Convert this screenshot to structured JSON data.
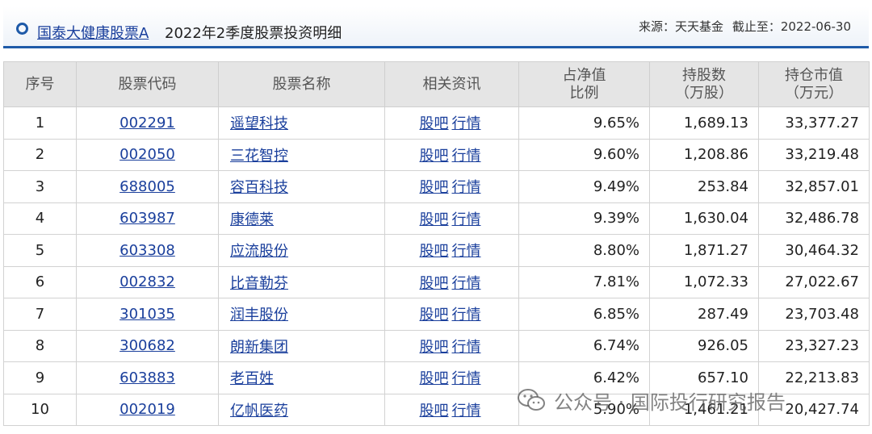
{
  "header": {
    "fund_name": "国泰大健康股票A",
    "title": "2022年2季度股票投资明细",
    "source_label": "来源：天天基金",
    "date_label": "截止至：2022-06-30"
  },
  "table": {
    "columns": [
      "序号",
      "股票代码",
      "股票名称",
      "相关资讯",
      "占净值比例",
      "持股数（万股）",
      "持仓市值（万元）"
    ],
    "column_lines": [
      [
        "序号"
      ],
      [
        "股票代码"
      ],
      [
        "股票名称"
      ],
      [
        "相关资讯"
      ],
      [
        "占净值",
        "比例"
      ],
      [
        "持股数",
        "（万股）"
      ],
      [
        "持仓市值",
        "（万元）"
      ]
    ],
    "info_links": [
      "股吧",
      "行情"
    ],
    "rows": [
      {
        "no": "1",
        "code": "002291",
        "name": "遥望科技",
        "pct": "9.65%",
        "shares": "1,689.13",
        "value": "33,377.27"
      },
      {
        "no": "2",
        "code": "002050",
        "name": "三花智控",
        "pct": "9.60%",
        "shares": "1,208.86",
        "value": "33,219.48"
      },
      {
        "no": "3",
        "code": "688005",
        "name": "容百科技",
        "pct": "9.49%",
        "shares": "253.84",
        "value": "32,857.01"
      },
      {
        "no": "4",
        "code": "603987",
        "name": "康德莱",
        "pct": "9.39%",
        "shares": "1,630.04",
        "value": "32,486.78"
      },
      {
        "no": "5",
        "code": "603308",
        "name": "应流股份",
        "pct": "8.80%",
        "shares": "1,871.27",
        "value": "30,464.32"
      },
      {
        "no": "6",
        "code": "002832",
        "name": "比音勒芬",
        "pct": "7.81%",
        "shares": "1,072.33",
        "value": "27,022.67"
      },
      {
        "no": "7",
        "code": "301035",
        "name": "润丰股份",
        "pct": "6.85%",
        "shares": "287.49",
        "value": "23,703.48"
      },
      {
        "no": "8",
        "code": "300682",
        "name": "朗新集团",
        "pct": "6.74%",
        "shares": "926.05",
        "value": "23,327.23"
      },
      {
        "no": "9",
        "code": "603883",
        "name": "老百姓",
        "pct": "6.42%",
        "shares": "657.10",
        "value": "22,213.83"
      },
      {
        "no": "10",
        "code": "002019",
        "name": "亿帆医药",
        "pct": "5.90%",
        "shares": "1,461.21",
        "value": "20,427.74"
      }
    ]
  },
  "watermark": {
    "icon": "wechat-icon",
    "text": "公众号 · 国际投行研究报告"
  },
  "colors": {
    "link": "#1a3f9c",
    "accent": "#1e5aa8",
    "header_bg": "#e5e5e5"
  }
}
